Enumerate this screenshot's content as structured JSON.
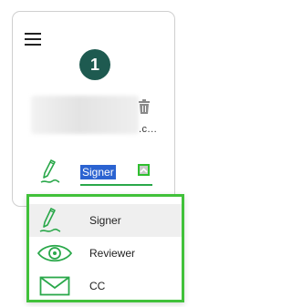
{
  "step": {
    "number": "1"
  },
  "recipient": {
    "email_suffix": ".c..."
  },
  "role_select": {
    "value": "Signer"
  },
  "role_options": [
    {
      "label": "Signer",
      "icon": "pen-icon",
      "selected": true
    },
    {
      "label": "Reviewer",
      "icon": "eye-icon",
      "selected": false
    },
    {
      "label": "CC",
      "icon": "envelope-icon",
      "selected": false
    }
  ],
  "colors": {
    "accent_green": "#2aa84a",
    "highlight_green": "#41c13a",
    "step_badge": "#1e5a50",
    "selection_blue": "#2b63d1"
  }
}
